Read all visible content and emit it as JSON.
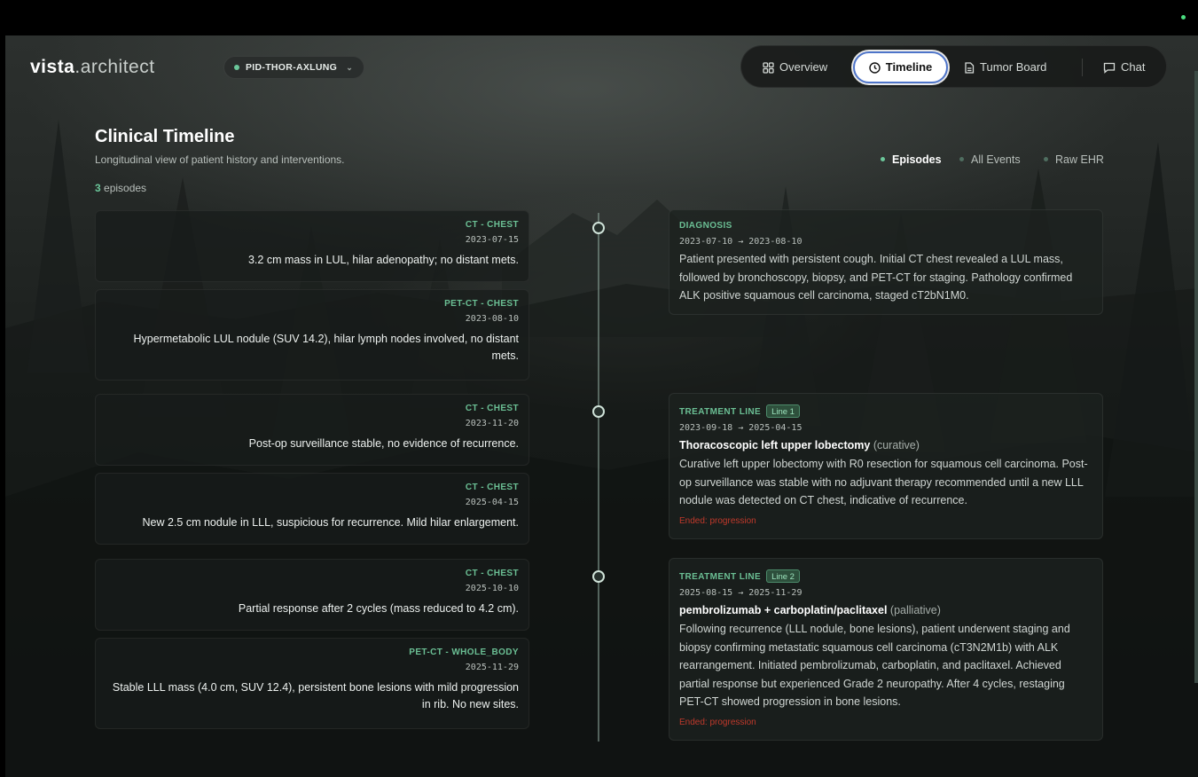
{
  "app": {
    "logo_bold": "vista",
    "logo_rest": ".architect"
  },
  "patient": {
    "id": "PID-THOR-AXLUNG"
  },
  "nav": {
    "overview": "Overview",
    "timeline": "Timeline",
    "tumor_board": "Tumor Board",
    "chat": "Chat"
  },
  "page": {
    "title": "Clinical Timeline",
    "subtitle": "Longitudinal view of patient history and interventions.",
    "episode_count": "3",
    "episode_count_label": " episodes"
  },
  "views": {
    "episodes": "Episodes",
    "all_events": "All Events",
    "raw_ehr": "Raw EHR"
  },
  "events": [
    {
      "type": "CT - CHEST",
      "date": "2023-07-15",
      "text": "3.2 cm mass in LUL, hilar adenopathy; no distant mets."
    },
    {
      "type": "PET-CT - CHEST",
      "date": "2023-08-10",
      "text": "Hypermetabolic LUL nodule (SUV 14.2), hilar lymph nodes involved, no distant mets."
    },
    {
      "type": "CT - CHEST",
      "date": "2023-11-20",
      "text": "Post-op surveillance stable, no evidence of recurrence."
    },
    {
      "type": "CT - CHEST",
      "date": "2025-04-15",
      "text": "New 2.5 cm nodule in LLL, suspicious for recurrence. Mild hilar enlargement."
    },
    {
      "type": "CT - CHEST",
      "date": "2025-10-10",
      "text": "Partial response after 2 cycles (mass reduced to 4.2 cm)."
    },
    {
      "type": "PET-CT - WHOLE_BODY",
      "date": "2025-11-29",
      "text": "Stable LLL mass (4.0 cm, SUV 12.4), persistent bone lesions with mild progression in rib. No new sites."
    }
  ],
  "episodes": [
    {
      "kind": "DIAGNOSIS",
      "dates": "2023-07-10 → 2023-08-10",
      "desc": "Patient presented with persistent cough. Initial CT chest revealed a LUL mass, followed by bronchoscopy, biopsy, and PET-CT for staging. Pathology confirmed ALK positive squamous cell carcinoma, staged cT2bN1M0."
    },
    {
      "kind": "TREATMENT LINE",
      "line": "Line 1",
      "dates": "2023-09-18 → 2025-04-15",
      "title": "Thoracoscopic left upper lobectomy",
      "intent": "(curative)",
      "desc": "Curative left upper lobectomy with R0 resection for squamous cell carcinoma. Post-op surveillance was stable with no adjuvant therapy recommended until a new LLL nodule was detected on CT chest, indicative of recurrence.",
      "ended": "Ended: progression"
    },
    {
      "kind": "TREATMENT LINE",
      "line": "Line 2",
      "dates": "2025-08-15 → 2025-11-29",
      "title": "pembrolizumab + carboplatin/paclitaxel",
      "intent": "(palliative)",
      "desc": "Following recurrence (LLL nodule, bone lesions), patient underwent staging and biopsy confirming metastatic squamous cell carcinoma (cT3N2M1b) with ALK rearrangement. Initiated pembrolizumab, carboplatin, and paclitaxel. Achieved partial response but experienced Grade 2 neuropathy. After 4 cycles, restaging PET-CT showed progression in bone lesions.",
      "ended": "Ended: progression"
    }
  ],
  "colors": {
    "accent": "#6bc79a",
    "active_ring": "#4e74c9",
    "ended": "#c0392b"
  },
  "icons": {
    "overview": "grid-icon",
    "timeline": "clock-icon",
    "tumor_board": "document-icon",
    "chat": "chat-bubble-icon",
    "pid": "status-dot-icon",
    "pid_menu": "chevron-down-icon"
  }
}
